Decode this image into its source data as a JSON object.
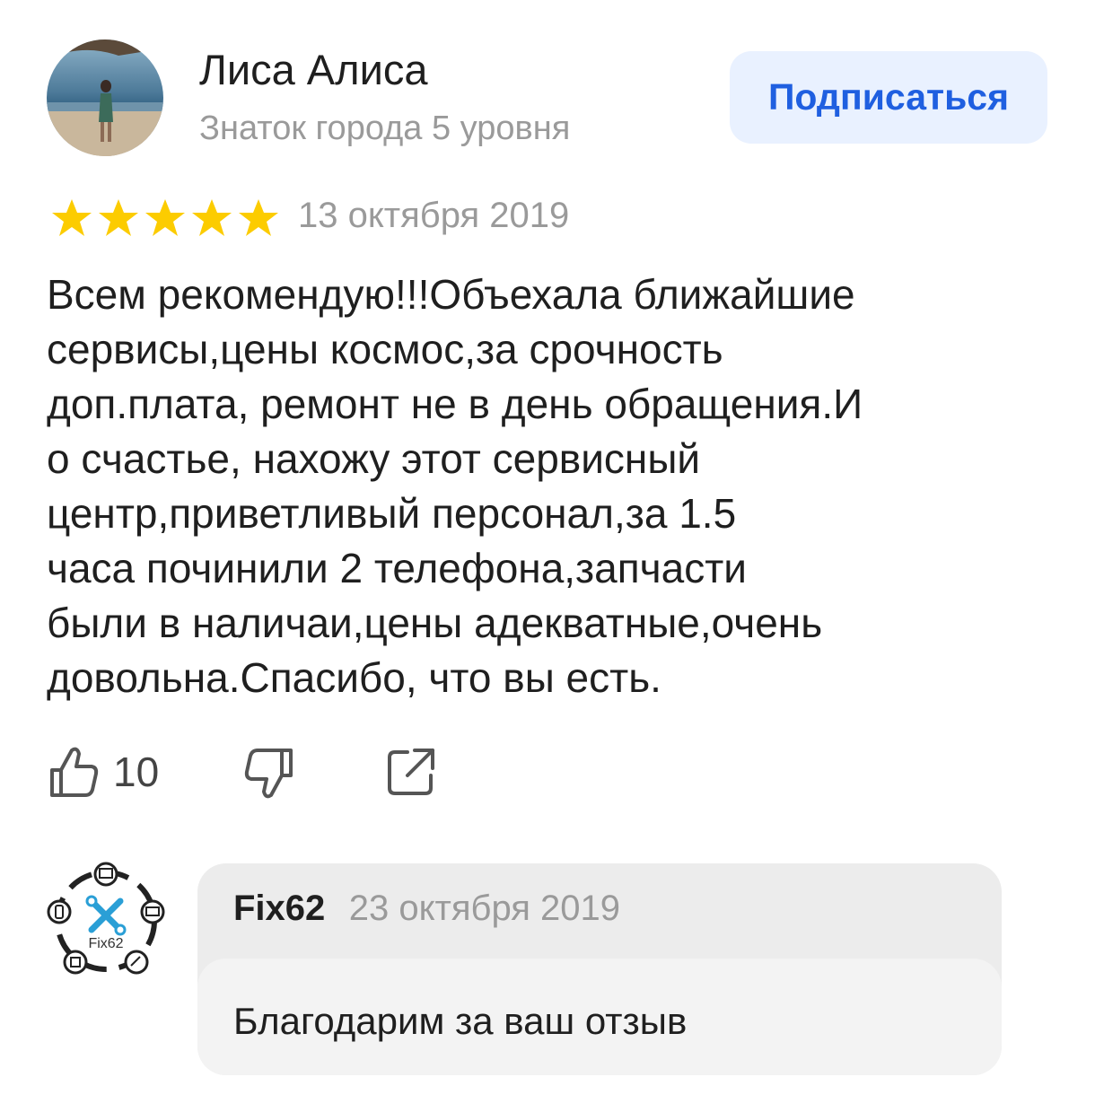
{
  "author": {
    "name": "Лиса Алиса",
    "level": "Знаток города 5 уровня",
    "avatar_icon": "user-photo-avatar"
  },
  "subscribe_label": "Подписаться",
  "review": {
    "rating": 5,
    "rating_max": 5,
    "date": "13 октября 2019",
    "lines": [
      "Всем рекомендую!!!Объехала ближайшие",
      "сервисы,цены космос,за срочность",
      "доп.плата, ремонт не в день обращения.И",
      "о счастье, нахожу этот сервисный",
      "центр,приветливый персонал,за 1.5",
      "часа починили 2 телефона,запчасти",
      "были в наличаи,цены адекватные,очень",
      "довольна.Спасибо, что вы есть."
    ]
  },
  "actions": {
    "like_count": "10",
    "like_icon": "thumbs-up-icon",
    "dislike_icon": "thumbs-down-icon",
    "share_icon": "share-icon"
  },
  "reply": {
    "author": "Fix62",
    "date": "23 октября 2019",
    "text": "Благодарим за ваш отзыв",
    "logo_text": "Fix62"
  },
  "colors": {
    "star": "#fccc00",
    "accent": "#1f5fe0",
    "button_bg": "#e9f1ff",
    "muted": "#9a9a9a"
  }
}
